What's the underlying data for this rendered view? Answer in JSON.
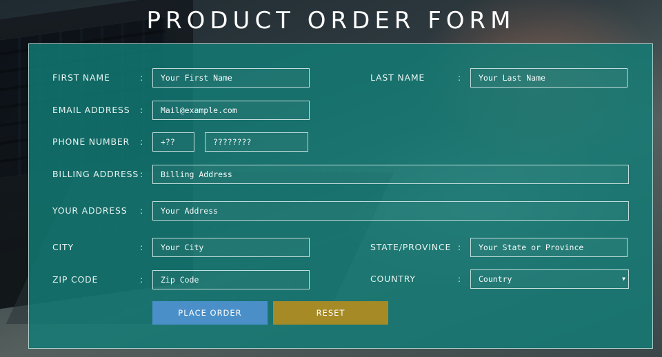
{
  "page": {
    "title": "PRODUCT ORDER FORM"
  },
  "form": {
    "colon": ":",
    "first_name": {
      "label": "FIRST NAME",
      "placeholder": "Your First Name"
    },
    "last_name": {
      "label": "LAST NAME",
      "placeholder": "Your Last Name"
    },
    "email": {
      "label": "EMAIL ADDRESS",
      "placeholder": "Mail@example.com"
    },
    "phone": {
      "label": "PHONE NUMBER",
      "code_placeholder": "+??",
      "number_placeholder": "????????"
    },
    "billing": {
      "label": "BILLING ADDRESS",
      "placeholder": "Billing Address"
    },
    "address": {
      "label": "YOUR ADDRESS",
      "placeholder": "Your Address"
    },
    "city": {
      "label": "CITY",
      "placeholder": "Your City"
    },
    "state": {
      "label": "STATE/PROVINCE",
      "placeholder": "Your State or Province"
    },
    "zip": {
      "label": "ZIP CODE",
      "placeholder": "Zip Code"
    },
    "country": {
      "label": "COUNTRY",
      "selected": "Country",
      "arrow_icon": "triangle-down"
    }
  },
  "buttons": {
    "place_order": {
      "label": "PLACE ORDER",
      "color": "#4a8fc8"
    },
    "reset": {
      "label": "RESET",
      "color": "#a68a26"
    }
  },
  "colors": {
    "panel": "#127d76",
    "text": "#e8f4f2"
  }
}
